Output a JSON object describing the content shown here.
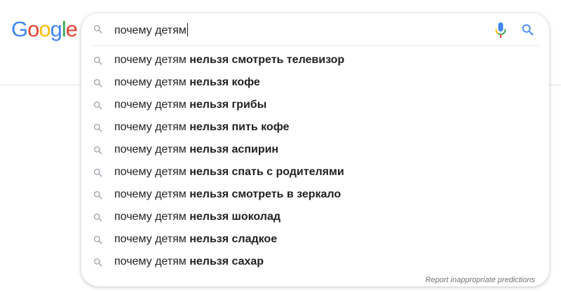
{
  "logo": {
    "letters": [
      {
        "char": "G",
        "color": "#4285F4"
      },
      {
        "char": "o",
        "color": "#EA4335"
      },
      {
        "char": "o",
        "color": "#FBBC05"
      },
      {
        "char": "g",
        "color": "#4285F4"
      },
      {
        "char": "l",
        "color": "#34A853"
      },
      {
        "char": "e",
        "color": "#EA4335"
      }
    ]
  },
  "search": {
    "query": "почему детям",
    "icons": {
      "left": "search-icon",
      "mic": "microphone-icon",
      "submit": "search-icon"
    }
  },
  "suggestions": [
    {
      "prefix": "почему детям",
      "completion": "нельзя смотреть телевизор"
    },
    {
      "prefix": "почему детям",
      "completion": "нельзя кофе"
    },
    {
      "prefix": "почему детям",
      "completion": "нельзя грибы"
    },
    {
      "prefix": "почему детям",
      "completion": "нельзя пить кофе"
    },
    {
      "prefix": "почему детям",
      "completion": "нельзя аспирин"
    },
    {
      "prefix": "почему детям",
      "completion": "нельзя спать с родителями"
    },
    {
      "prefix": "почему детям",
      "completion": "нельзя смотреть в зеркало"
    },
    {
      "prefix": "почему детям",
      "completion": "нельзя шоколад"
    },
    {
      "prefix": "почему детям",
      "completion": "нельзя сладкое"
    },
    {
      "prefix": "почему детям",
      "completion": "нельзя сахар"
    }
  ],
  "footer": {
    "report_label": "Report inappropriate predictions"
  },
  "colors": {
    "text": "#202124",
    "icon_gray": "#9aa0a6",
    "search_blue": "#4285F4",
    "mic_red": "#EA4335",
    "mic_yellow": "#FBBC05",
    "mic_green": "#34A853"
  }
}
